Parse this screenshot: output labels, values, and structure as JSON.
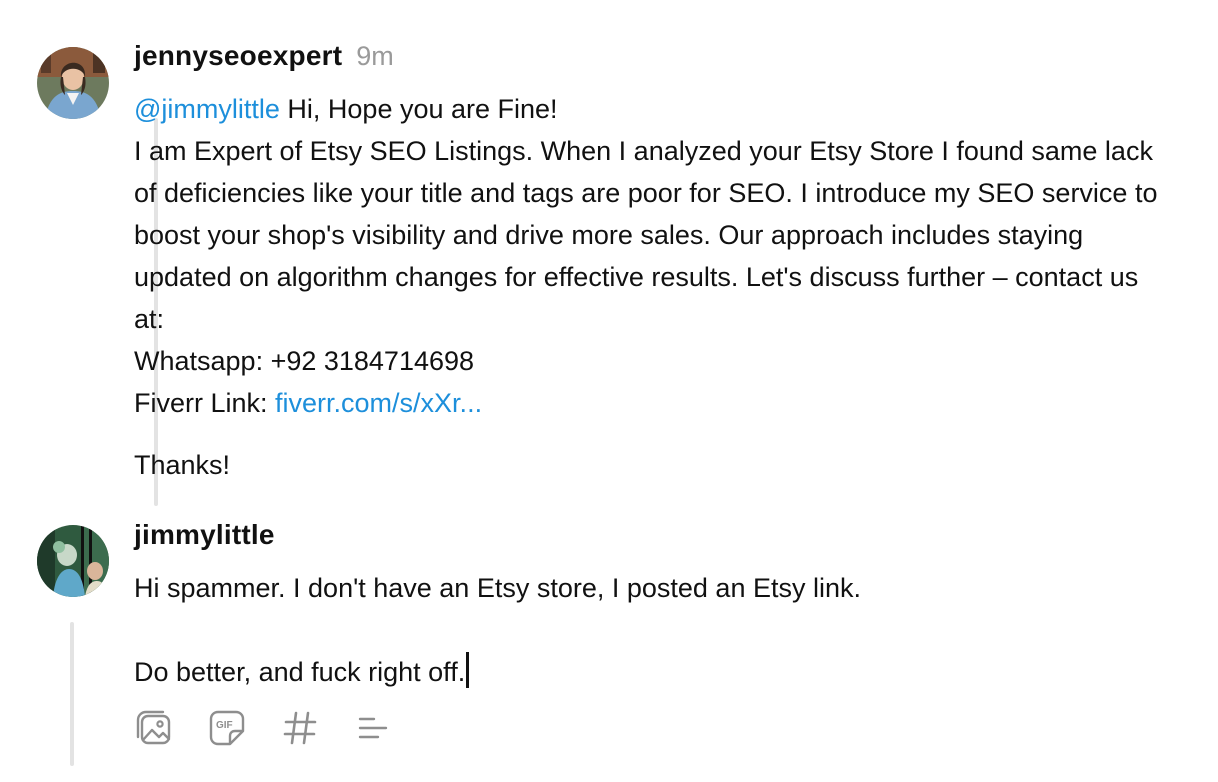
{
  "posts": [
    {
      "username": "jennyseoexpert",
      "timestamp": "9m",
      "mention": "@jimmylittle",
      "greeting": " Hi, Hope you are Fine!",
      "paragraph": "I am Expert of Etsy SEO Listings. When I analyzed your Etsy Store I found same lack of deficiencies like your title and tags are poor for SEO. I introduce my SEO service to boost your shop's visibility and drive more sales. Our approach includes staying updated on algorithm changes for effective results. Let's discuss further – contact us at:",
      "whatsapp": "Whatsapp: +92 3184714698",
      "fiverr_label": "Fiverr Link: ",
      "fiverr_link": "fiverr.com/s/xXr...",
      "signoff": "Thanks!"
    }
  ],
  "reply": {
    "username": "jimmylittle",
    "line1": "Hi spammer. I don't have an Etsy store, I posted an Etsy link.",
    "line2": "Do better, and fuck right off."
  },
  "toolbar": {
    "items": [
      {
        "icon": "image-icon"
      },
      {
        "icon": "gif-icon"
      },
      {
        "icon": "hashtag-icon"
      },
      {
        "icon": "list-icon"
      }
    ]
  },
  "colors": {
    "link": "#1d8fdb",
    "muted": "#9a9a9a",
    "text": "#111111",
    "thread_line": "#e3e3e3"
  }
}
